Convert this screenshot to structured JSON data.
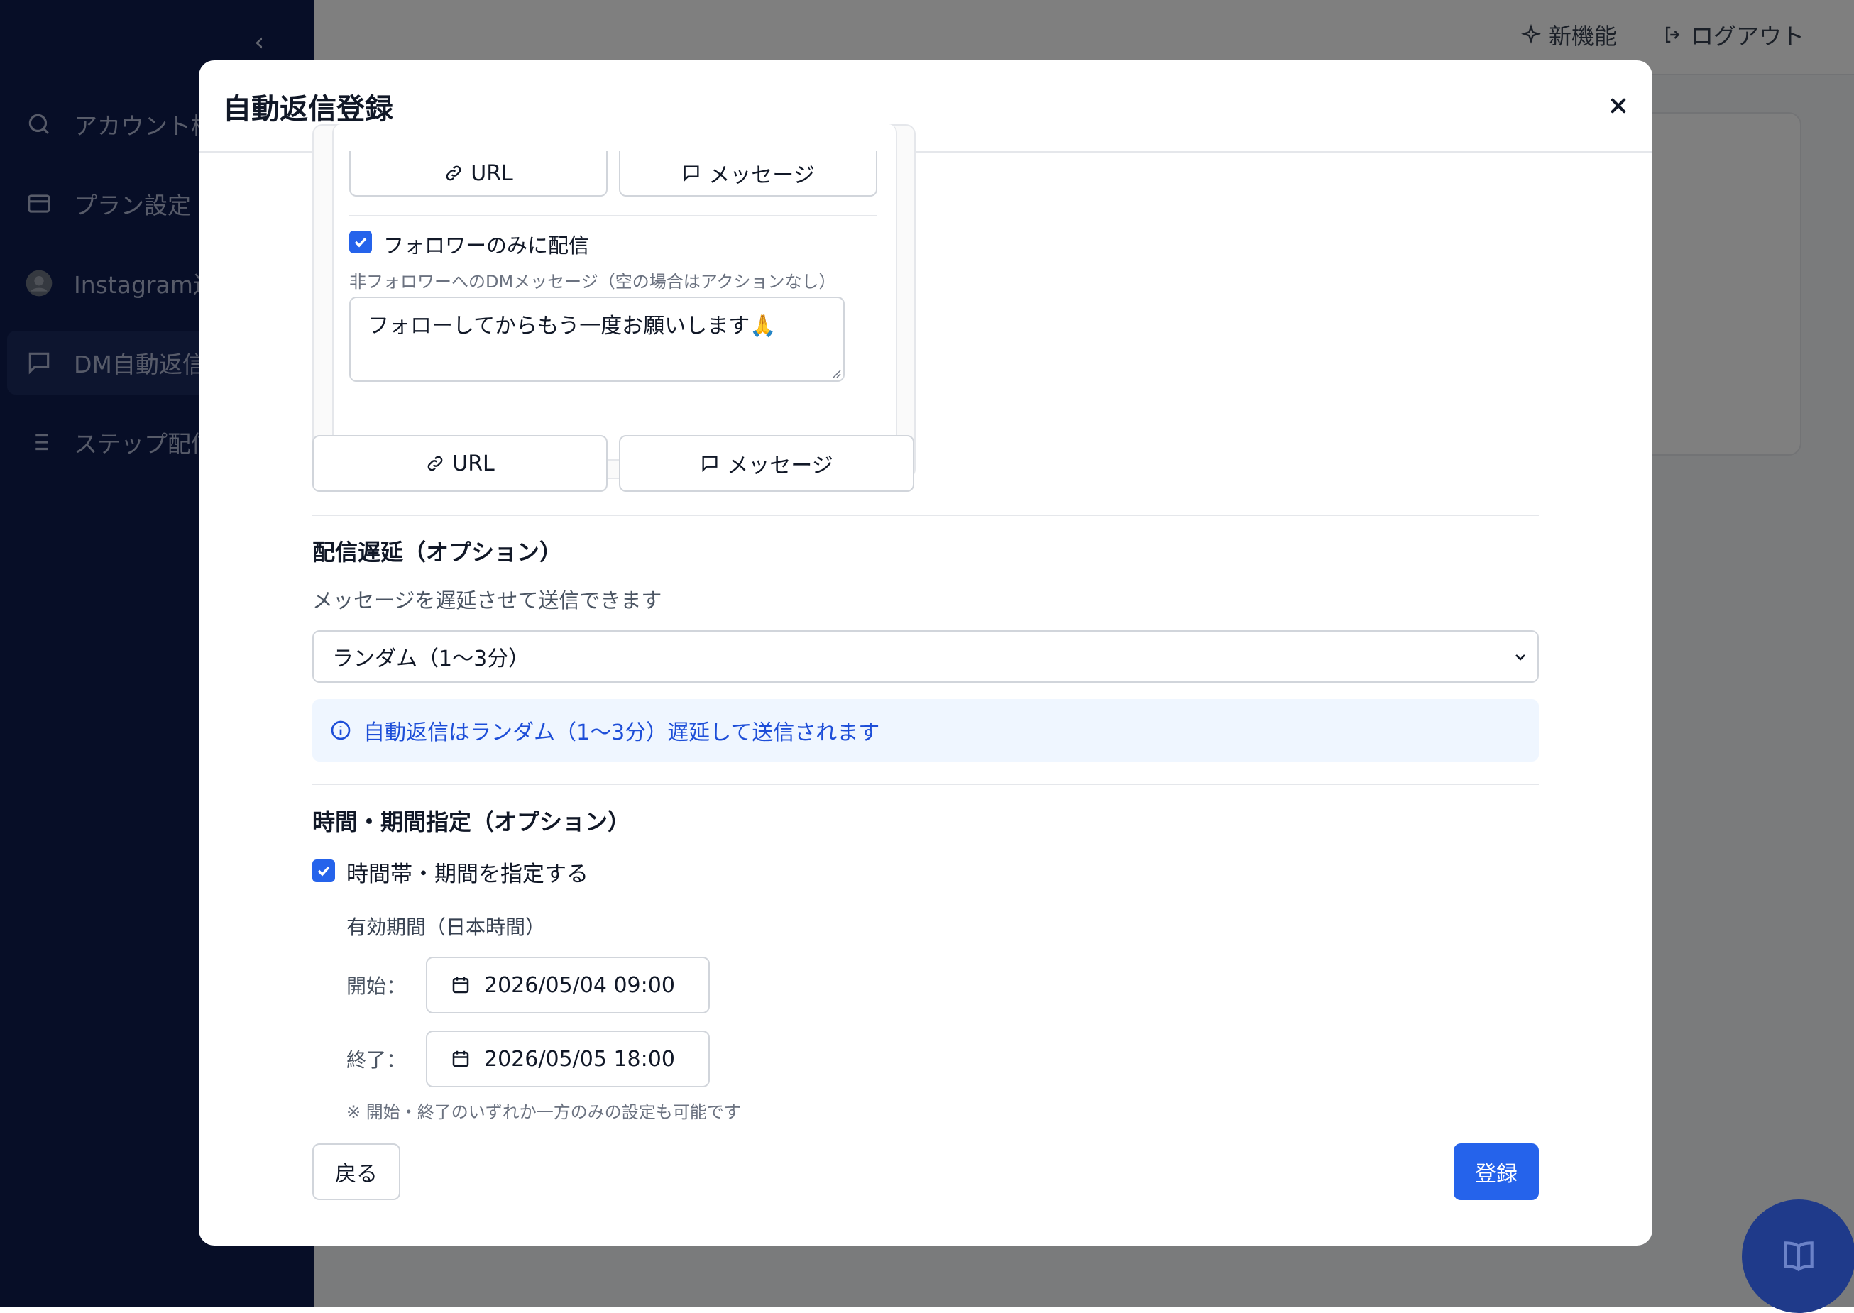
{
  "sidebar": {
    "items": [
      {
        "label": "アカウント検",
        "icon": "search-icon"
      },
      {
        "label": "プラン設定",
        "icon": "credit-card-icon"
      },
      {
        "label": "Instagram連",
        "icon": "avatar-icon"
      },
      {
        "label": "DM自動返信",
        "icon": "chat-icon"
      },
      {
        "label": "ステップ配信",
        "icon": "list-icon"
      }
    ]
  },
  "header": {
    "new_features": "新機能",
    "logout": "ログアウト"
  },
  "modal": {
    "title": "自動返信登録",
    "nested": {
      "url_label": "URL",
      "message_label": "メッセージ",
      "followers_only_label": "フォロワーのみに配信",
      "followers_only_checked": true,
      "non_follower_hint": "非フォロワーへのDMメッセージ（空の場合はアクションなし）",
      "non_follower_message": "フォローしてからもう一度お願いします🙏"
    },
    "actions": {
      "url_label": "URL",
      "message_label": "メッセージ"
    },
    "delay": {
      "heading": "配信遅延（オプション）",
      "description": "メッセージを遅延させて送信できます",
      "selected": "ランダム（1〜3分）",
      "info": "自動返信はランダム（1〜3分）遅延して送信されます"
    },
    "schedule": {
      "heading": "時間・期間指定（オプション）",
      "enable_label": "時間帯・期間を指定する",
      "enable_checked": true,
      "period_label": "有効期間（日本時間）",
      "start_label": "開始：",
      "start_value": "2026/05/04 09:00",
      "end_label": "終了：",
      "end_value": "2026/05/05 18:00",
      "note": "※ 開始・終了のいずれか一方のみの設定も可能です"
    },
    "back_label": "戻る",
    "submit_label": "登録"
  },
  "colors": {
    "sidebar_bg": "#0f1d4f",
    "primary": "#2563eb",
    "info_bg": "#eff6ff",
    "info_text": "#1d4ed8"
  }
}
